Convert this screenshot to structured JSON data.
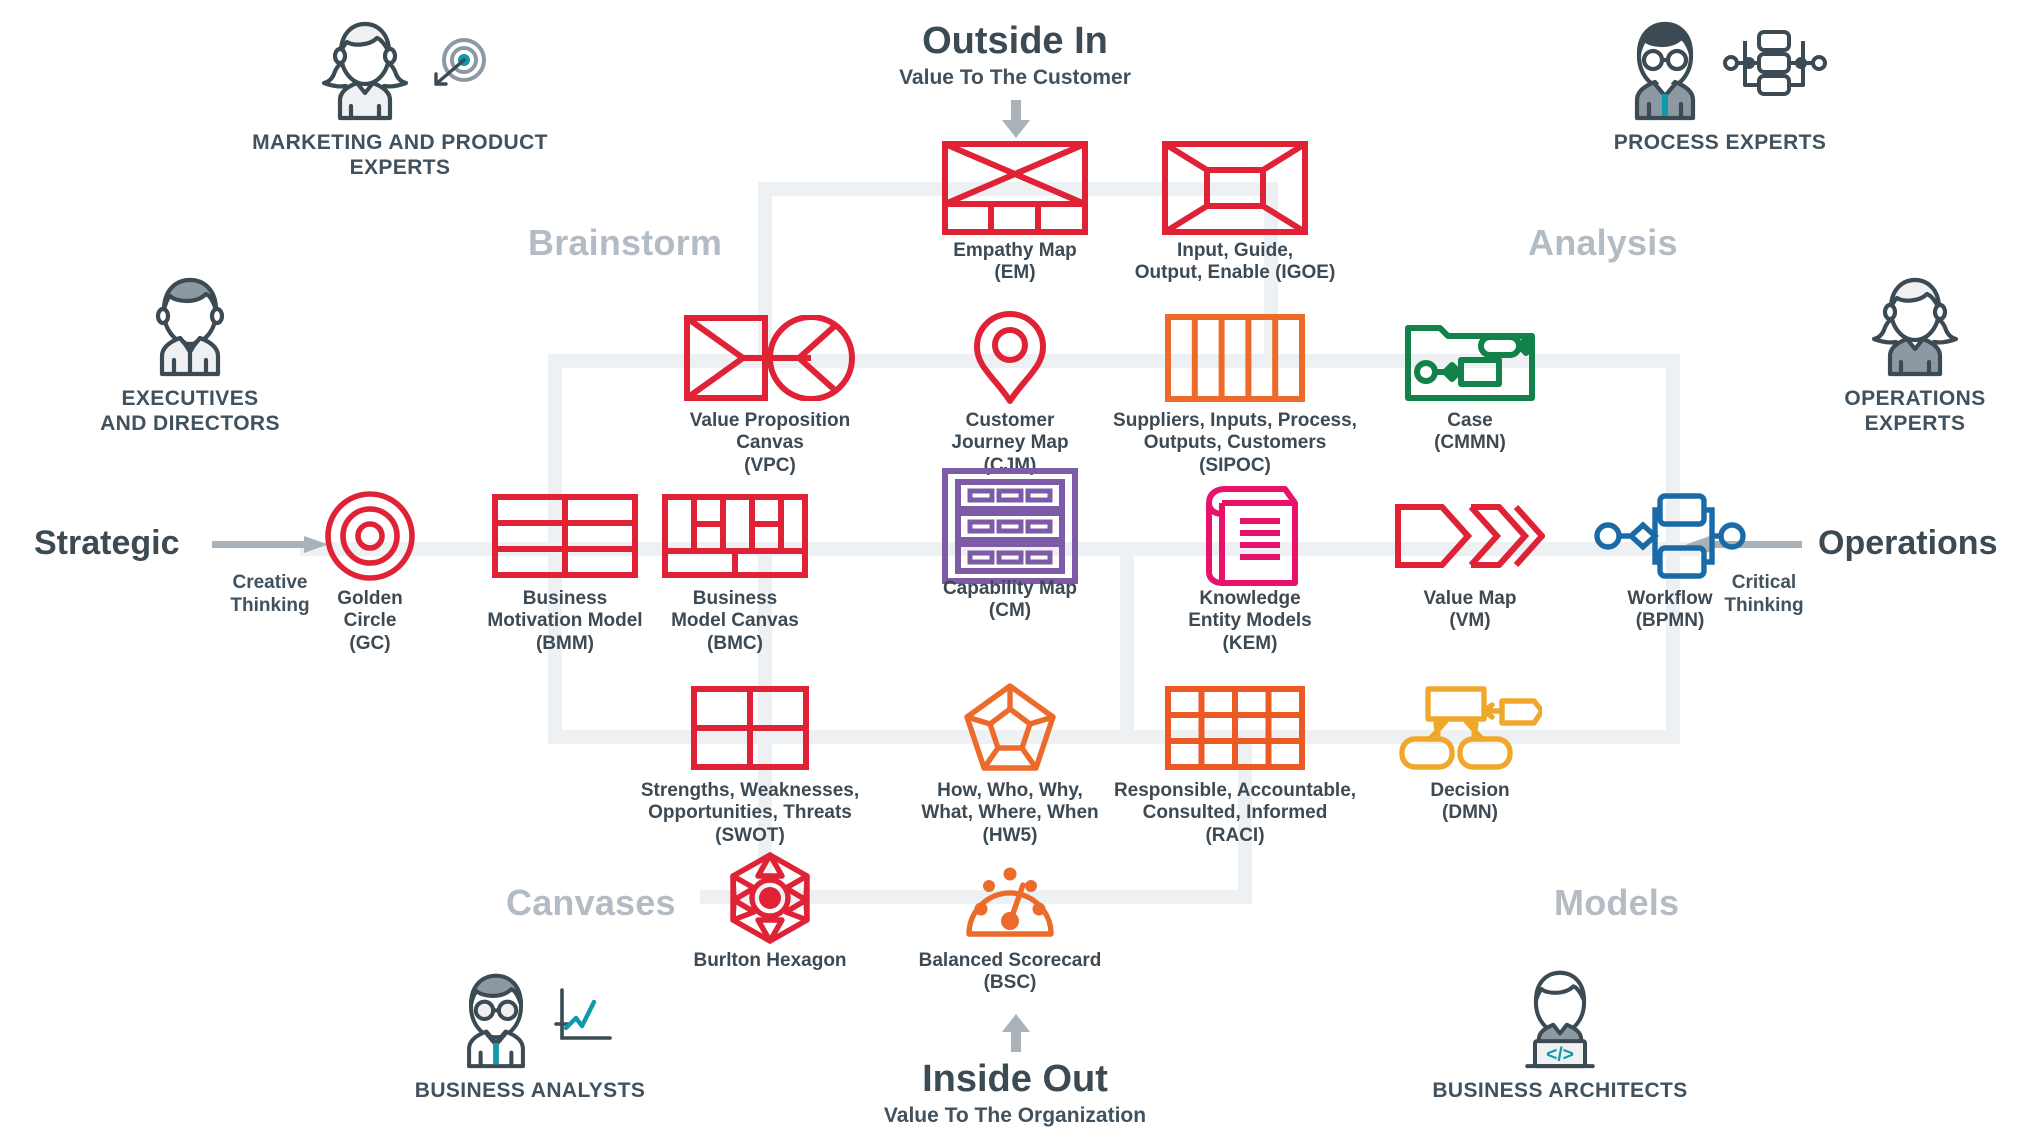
{
  "headers": {
    "top": {
      "title": "Outside In",
      "subtitle": "Value To The Customer",
      "arrow": "down-arrow"
    },
    "bottom": {
      "title": "Inside Out",
      "subtitle": "Value To The Organization",
      "arrow": "up-arrow"
    },
    "left": {
      "title": "Strategic",
      "sub": "Creative\nThinking",
      "arrow": "right-arrow"
    },
    "right": {
      "title": "Operations",
      "sub": "Critical\nThinking",
      "arrow": "left-arrow"
    }
  },
  "sections": [
    {
      "label": "Brainstorm",
      "quadrant": "top-left"
    },
    {
      "label": "Analysis",
      "quadrant": "top-right"
    },
    {
      "label": "Canvases",
      "quadrant": "bottom-left"
    },
    {
      "label": "Models",
      "quadrant": "bottom-right"
    }
  ],
  "personas": [
    {
      "id": "marketing-and-product-experts",
      "label": "MARKETING AND PRODUCT\nEXPERTS",
      "icon": "female-avatar-with-target-icon"
    },
    {
      "id": "process-experts",
      "label": "PROCESS EXPERTS",
      "icon": "male-avatar-with-flowchart-icon"
    },
    {
      "id": "executives-and-directors",
      "label": "EXECUTIVES\nAND DIRECTORS",
      "icon": "executive-avatar-icon"
    },
    {
      "id": "operations-experts",
      "label": "OPERATIONS\nEXPERTS",
      "icon": "female-avatar-icon"
    },
    {
      "id": "business-analysts",
      "label": "BUSINESS ANALYSTS",
      "icon": "analyst-avatar-with-chart-icon"
    },
    {
      "id": "business-architects",
      "label": "BUSINESS ARCHITECTS",
      "icon": "architect-avatar-with-laptop-icon"
    }
  ],
  "tools": [
    {
      "id": "empathy-map",
      "label": "Empathy Map\n(EM)",
      "icon": "empathy-map-icon",
      "color": "#e02236"
    },
    {
      "id": "igoe",
      "label": "Input, Guide,\nOutput, Enable (IGOE)",
      "icon": "igoe-icon",
      "color": "#e02236"
    },
    {
      "id": "value-proposition-canvas",
      "label": "Value Proposition\nCanvas\n(VPC)",
      "icon": "value-proposition-icon",
      "color": "#e02236"
    },
    {
      "id": "customer-journey-map",
      "label": "Customer\nJourney Map\n(CJM)",
      "icon": "map-pin-icon",
      "color": "#e02236"
    },
    {
      "id": "sipoc",
      "label": "Suppliers, Inputs, Process,\nOutputs, Customers\n(SIPOC)",
      "icon": "sipoc-columns-icon",
      "color": "#ec6a2a"
    },
    {
      "id": "case-cmmn",
      "label": "Case\n(CMMN)",
      "icon": "case-folder-icon",
      "color": "#13814a"
    },
    {
      "id": "golden-circle",
      "label": "Golden\nCircle\n(GC)",
      "icon": "concentric-circles-icon",
      "color": "#e02236"
    },
    {
      "id": "business-motivation-model",
      "label": "Business\nMotivation Model\n(BMM)",
      "icon": "grid-2x3-icon",
      "color": "#e02236"
    },
    {
      "id": "business-model-canvas",
      "label": "Business\nModel Canvas\n(BMC)",
      "icon": "bmc-grid-icon",
      "color": "#e02236"
    },
    {
      "id": "capability-map",
      "label": "Capability Map\n(CM)",
      "icon": "capability-rows-icon",
      "color": "#7d5ba6"
    },
    {
      "id": "knowledge-entity-models",
      "label": "Knowledge\nEntity Models\n(KEM)",
      "icon": "book-icon",
      "color": "#e8126b"
    },
    {
      "id": "value-map",
      "label": "Value Map\n(VM)",
      "icon": "chevron-stream-icon",
      "color": "#e02236"
    },
    {
      "id": "workflow-bpmn",
      "label": "Workflow\n(BPMN)",
      "icon": "bpmn-flow-icon",
      "color": "#1a6aa8"
    },
    {
      "id": "swot",
      "label": "Strengths, Weaknesses,\nOpportunities, Threats\n(SWOT)",
      "icon": "quadrant-2x2-icon",
      "color": "#e02236"
    },
    {
      "id": "hw5",
      "label": "How, Who, Why,\nWhat, Where, When\n(HW5)",
      "icon": "pentagon-icon",
      "color": "#ec6a2a"
    },
    {
      "id": "raci",
      "label": "Responsible, Accountable,\nConsulted, Informed\n(RACI)",
      "icon": "grid-4x3-icon",
      "color": "#ec5a24"
    },
    {
      "id": "decision-dmn",
      "label": "Decision\n(DMN)",
      "icon": "dmn-tree-icon",
      "color": "#f0a82a"
    },
    {
      "id": "burlton-hexagon",
      "label": "Burlton Hexagon",
      "icon": "hexagon-burst-icon",
      "color": "#e02236"
    },
    {
      "id": "balanced-scorecard",
      "label": "Balanced Scorecard\n(BSC)",
      "icon": "gauge-icon",
      "color": "#ec6a2a"
    }
  ],
  "colors": {
    "ink": "#3c4a53",
    "rail": "#eef1f3",
    "muted": "#b3bcc4",
    "arrow": "#a8b2b8",
    "red": "#e02236",
    "orange": "#ec6a2a",
    "deep_orange": "#ec5a24",
    "green": "#13814a",
    "purple": "#7d5ba6",
    "magenta": "#e8126b",
    "blue": "#1a6aa8",
    "amber": "#f0a82a",
    "teal": "#0e9aab"
  }
}
